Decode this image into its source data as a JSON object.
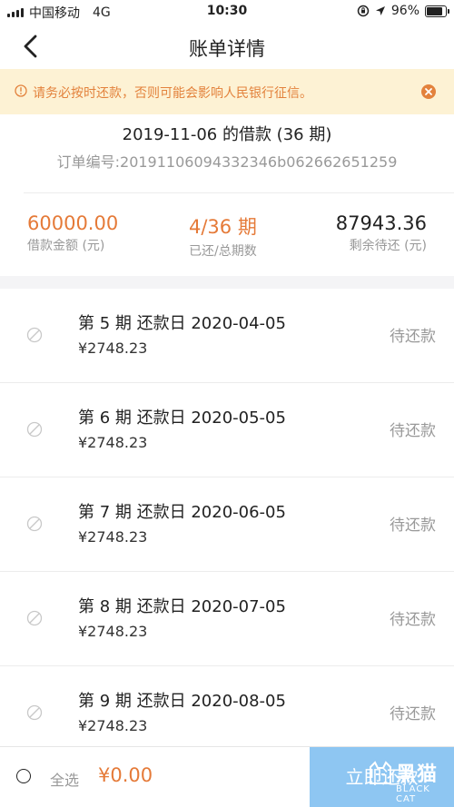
{
  "status_bar": {
    "carrier": "中国移动",
    "network": "4G",
    "time": "10:30",
    "battery": "96%",
    "battery_level": 0.96
  },
  "nav": {
    "title": "账单详情"
  },
  "notice": {
    "text": "请务必按时还款，否则可能会影响人民银行征信。"
  },
  "loan": {
    "title": "2019-11-06 的借款 (36 期)",
    "order_label": "订单编号:",
    "order_number": "20191106094332346b062662651259",
    "amount_value": "60000.00",
    "amount_label": "借款金额 (元)",
    "periods_value": "4/36 期",
    "periods_label": "已还/总期数",
    "remaining_value": "87943.36",
    "remaining_label": "剩余待还 (元)"
  },
  "installments": [
    {
      "period": "第 5 期  还款日 2020-04-05",
      "amount": "¥2748.23",
      "status": "待还款"
    },
    {
      "period": "第 6 期  还款日 2020-05-05",
      "amount": "¥2748.23",
      "status": "待还款"
    },
    {
      "period": "第 7 期  还款日 2020-06-05",
      "amount": "¥2748.23",
      "status": "待还款"
    },
    {
      "period": "第 8 期  还款日 2020-07-05",
      "amount": "¥2748.23",
      "status": "待还款"
    },
    {
      "period": "第 9 期  还款日 2020-08-05",
      "amount": "¥2748.23",
      "status": "待还款"
    }
  ],
  "footer": {
    "select_all": "全选",
    "total": "¥0.00",
    "pay_button": "立即还款"
  },
  "watermark": {
    "text": "黑猫",
    "sub": "BLACK CAT"
  },
  "colors": {
    "accent": "#e57a38",
    "notice_bg": "#fdf2d4",
    "pay_button": "#8ec6f2"
  }
}
